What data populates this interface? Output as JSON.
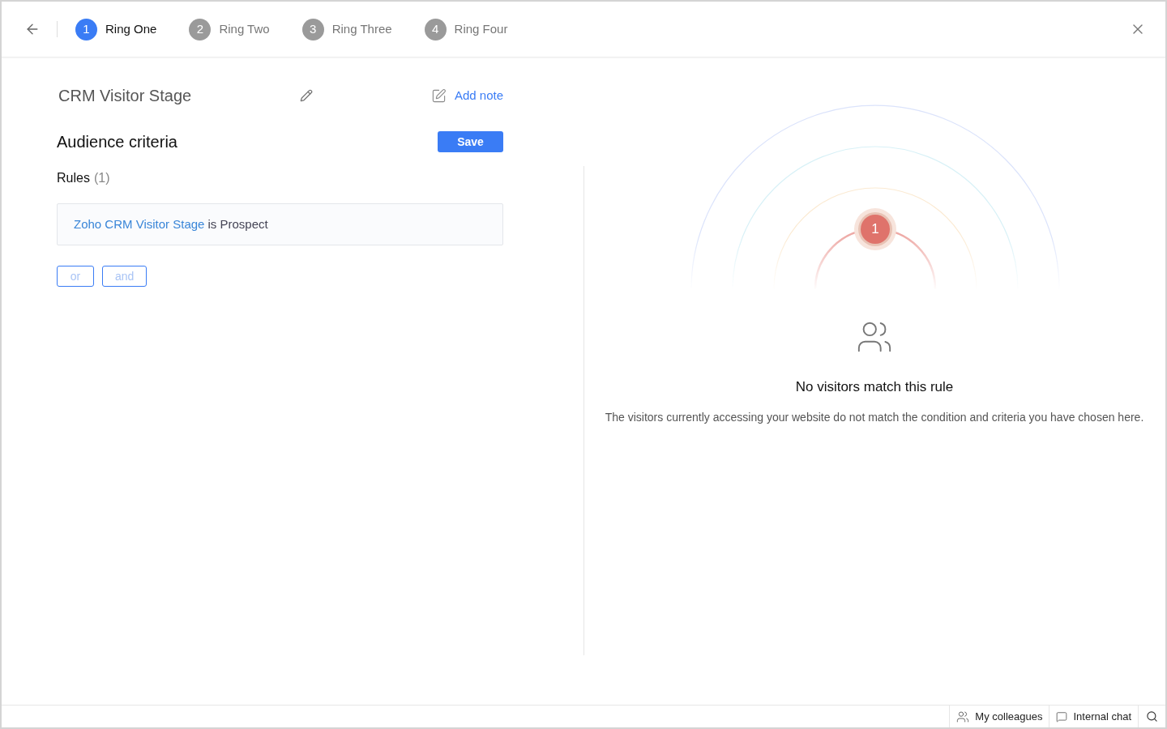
{
  "steps": [
    {
      "number": "1",
      "label": "Ring One",
      "selected": true
    },
    {
      "number": "2",
      "label": "Ring Two",
      "selected": false
    },
    {
      "number": "3",
      "label": "Ring Three",
      "selected": false
    },
    {
      "number": "4",
      "label": "Ring Four",
      "selected": false
    }
  ],
  "rule_name": "CRM Visitor Stage",
  "add_note": "Add note",
  "section_title": "Audience criteria",
  "save_button": "Save",
  "rules_label": "Rules",
  "rules_count": "(1)",
  "rules": [
    {
      "field": "Zoho CRM Visitor Stage",
      "condition": "is Prospect"
    }
  ],
  "connectors": [
    "or",
    "and"
  ],
  "ring_badge": "1",
  "empty_title": "No visitors match this rule",
  "empty_message": "The visitors currently accessing your website do not match the condition and criteria you have chosen here.",
  "footer": {
    "colleagues": "My colleagues",
    "chat": "Internal chat"
  }
}
